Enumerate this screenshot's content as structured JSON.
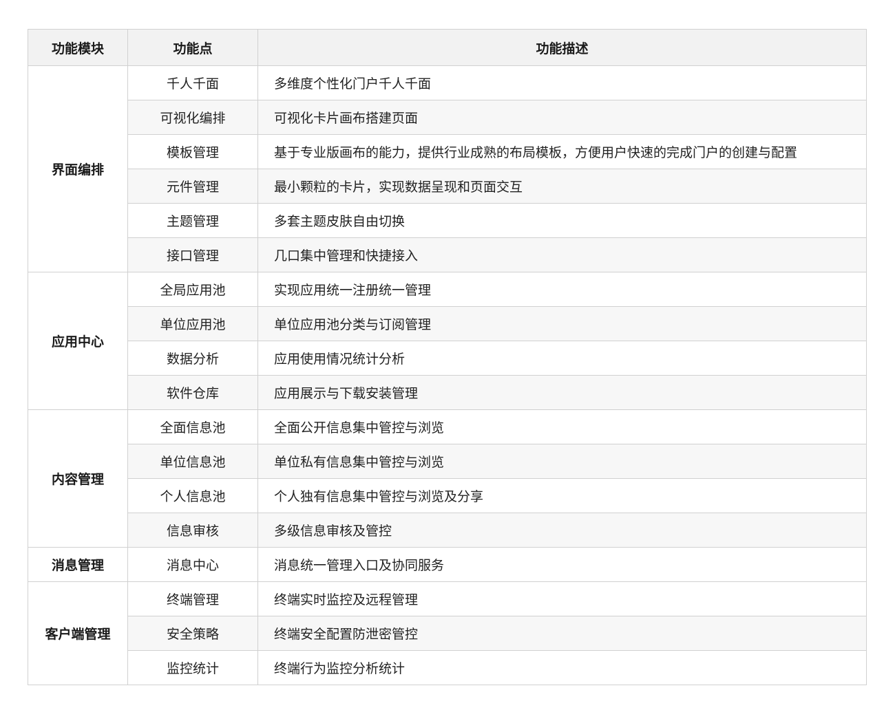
{
  "headers": [
    "功能模块",
    "功能点",
    "功能描述"
  ],
  "groups": [
    {
      "module": "界面编排",
      "rows": [
        {
          "point": "千人千面",
          "desc": "多维度个性化门户千人千面"
        },
        {
          "point": "可视化编排",
          "desc": "可视化卡片画布搭建页面"
        },
        {
          "point": "模板管理",
          "desc": "基于专业版画布的能力，提供行业成熟的布局模板，方便用户快速的完成门户的创建与配置"
        },
        {
          "point": "元件管理",
          "desc": "最小颗粒的卡片，实现数据呈现和页面交互"
        },
        {
          "point": "主题管理",
          "desc": "多套主题皮肤自由切换"
        },
        {
          "point": "接口管理",
          "desc": "几口集中管理和快捷接入"
        }
      ]
    },
    {
      "module": "应用中心",
      "rows": [
        {
          "point": "全局应用池",
          "desc": "实现应用统一注册统一管理"
        },
        {
          "point": "单位应用池",
          "desc": "单位应用池分类与订阅管理"
        },
        {
          "point": "数据分析",
          "desc": "应用使用情况统计分析"
        },
        {
          "point": "软件仓库",
          "desc": "应用展示与下载安装管理"
        }
      ]
    },
    {
      "module": "内容管理",
      "rows": [
        {
          "point": "全面信息池",
          "desc": "全面公开信息集中管控与浏览"
        },
        {
          "point": "单位信息池",
          "desc": "单位私有信息集中管控与浏览"
        },
        {
          "point": "个人信息池",
          "desc": "个人独有信息集中管控与浏览及分享"
        },
        {
          "point": "信息审核",
          "desc": "多级信息审核及管控"
        }
      ]
    },
    {
      "module": "消息管理",
      "rows": [
        {
          "point": "消息中心",
          "desc": "消息统一管理入口及协同服务"
        }
      ]
    },
    {
      "module": "客户端管理",
      "rows": [
        {
          "point": "终端管理",
          "desc": "终端实时监控及远程管理"
        },
        {
          "point": "安全策略",
          "desc": "终端安全配置防泄密管控"
        },
        {
          "point": "监控统计",
          "desc": "终端行为监控分析统计"
        }
      ]
    }
  ]
}
